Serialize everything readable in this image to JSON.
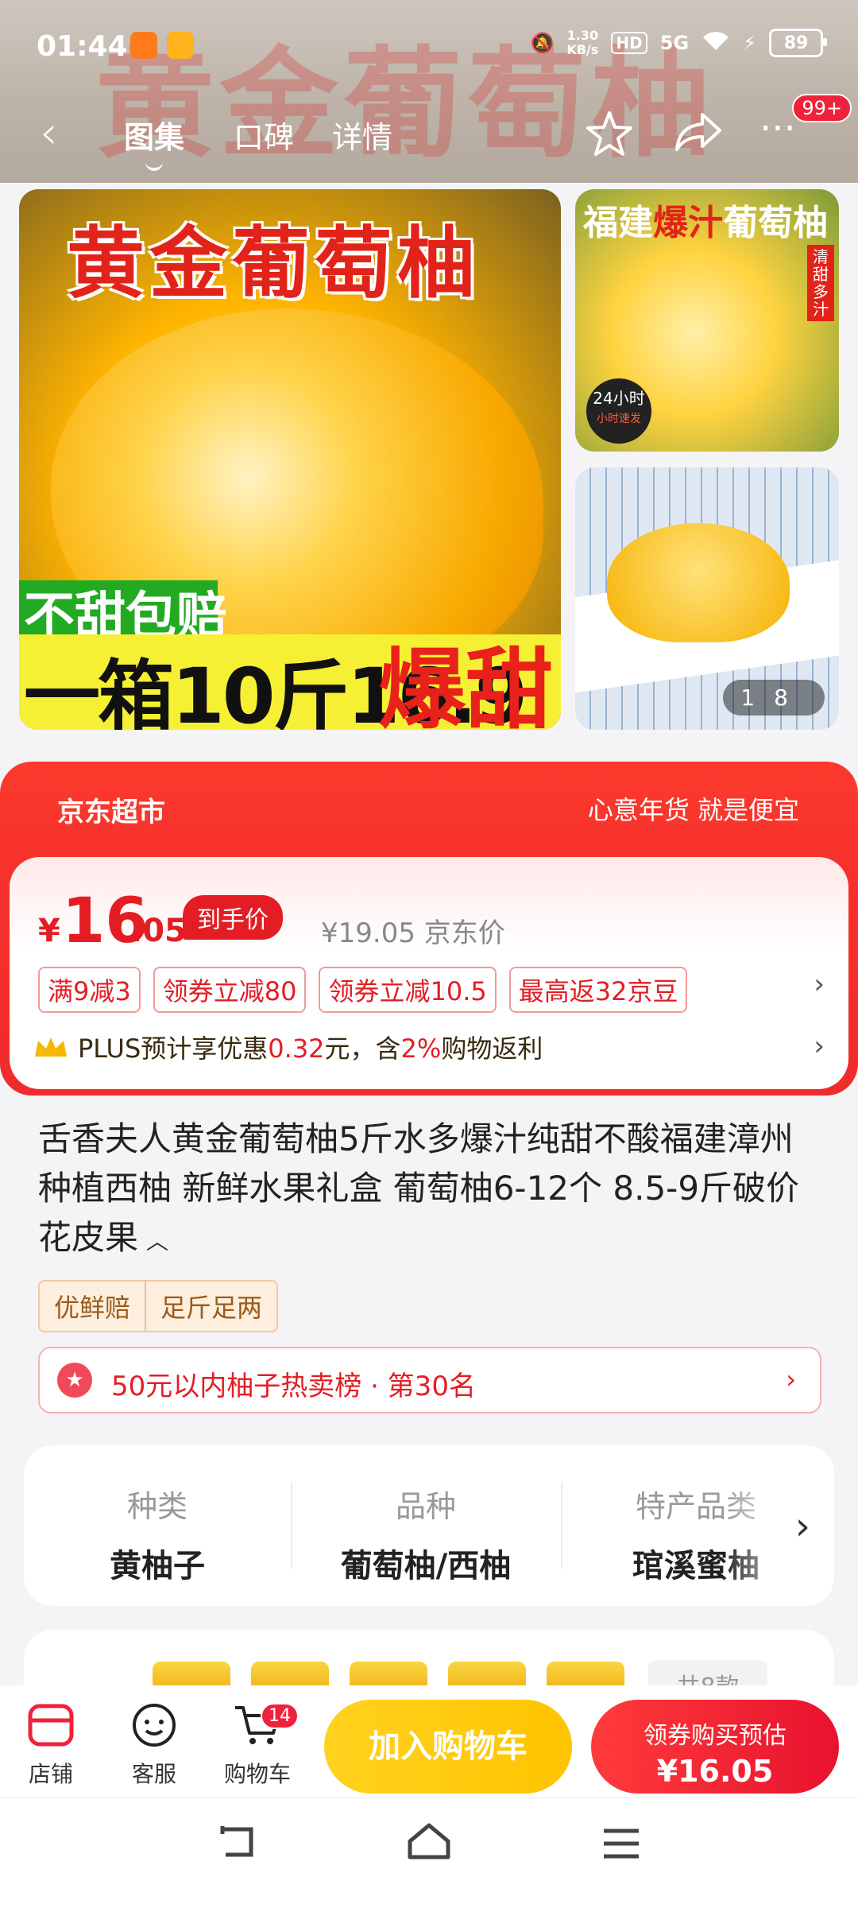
{
  "status_bar": {
    "time": "01:44",
    "net_speed_value": "1.30",
    "net_speed_unit": "KB/s",
    "hd": "HD",
    "network": "5G",
    "battery": "89"
  },
  "nav": {
    "tabs": [
      "图集",
      "口碑",
      "详情"
    ],
    "more_badge": "99+",
    "banner_bg_text": "黄金葡萄柚"
  },
  "gallery": {
    "main": {
      "title": "黄金葡萄柚",
      "badge": "不甜包赔",
      "price_line": "一箱10斤16.9",
      "sweet": "爆甜"
    },
    "side1": {
      "title_prefix": "福建",
      "title_highlight": "爆汁",
      "title_suffix": "葡萄柚",
      "vertical": "清甜多汁",
      "circle_top": "24小时",
      "circle_bottom": "小时速发"
    },
    "pager_current": "1",
    "pager_total": "8"
  },
  "price_card": {
    "brand": "京东超市",
    "slogan": "心意年货 就是便宜",
    "currency": "¥",
    "price_int": "16",
    "price_dec": ".05",
    "price_tag": "到手价",
    "orig_price": "¥19.05 京东价",
    "coupons": [
      "满9减3",
      "领券立减80",
      "领券立减10.5",
      "最高返32京豆"
    ],
    "plus_prefix": "PLUS预计享优惠",
    "plus_amount": "0.32",
    "plus_mid": "元，含",
    "plus_pct": "2%",
    "plus_suffix": "购物返利"
  },
  "product": {
    "title": "舌香夫人黄金葡萄柚5斤水多爆汁纯甜不酸福建漳州种植西柚 新鲜水果礼盒 葡萄柚6-12个 8.5-9斤破价花皮果",
    "chips": [
      "优鲜赔",
      "足斤足两"
    ],
    "rank": "50元以内柚子热卖榜 · 第30名"
  },
  "attributes": [
    {
      "key": "种类",
      "value": "黄柚子"
    },
    {
      "key": "品种",
      "value": "葡萄柚/西柚"
    },
    {
      "key": "特产品类",
      "value": "琯溪蜜柚"
    }
  ],
  "sku_more": "共8款",
  "bottom_bar": {
    "shop": "店铺",
    "service": "客服",
    "cart": "购物车",
    "cart_count": "14",
    "add_to_cart": "加入购物车",
    "buy_line1": "领券购买预估",
    "buy_line2": "¥16.05"
  }
}
